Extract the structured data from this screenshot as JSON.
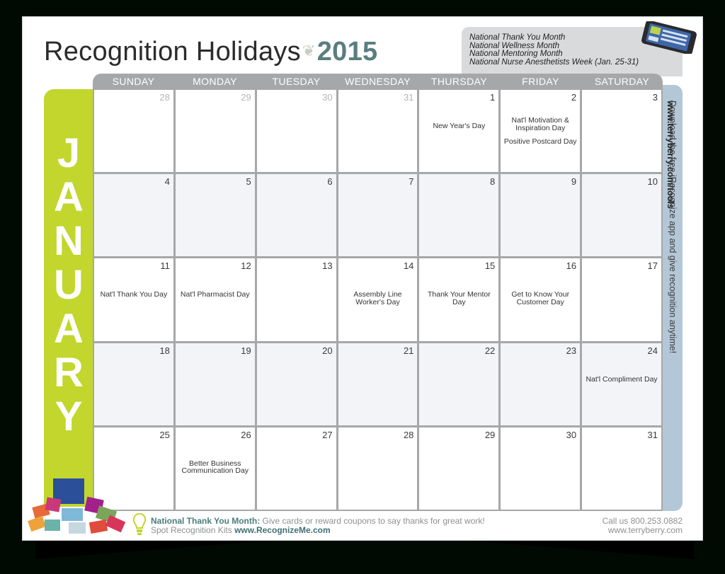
{
  "title": {
    "text": "Recognition Holidays",
    "ornament": "❦",
    "year": "2015"
  },
  "observances": [
    "National Thank You Month",
    "National Wellness Month",
    "National Mentoring Month",
    "National Nurse Anesthetists Week (Jan. 25-31)"
  ],
  "month": "JANUARY",
  "month_letters": [
    "J",
    "A",
    "N",
    "U",
    "A",
    "R",
    "Y"
  ],
  "weekdays": [
    "SUNDAY",
    "MONDAY",
    "TUESDAY",
    "WEDNESDAY",
    "THURSDAY",
    "FRIDAY",
    "SATURDAY"
  ],
  "weeks": [
    [
      {
        "day": "28",
        "outside": true,
        "events": []
      },
      {
        "day": "29",
        "outside": true,
        "events": []
      },
      {
        "day": "30",
        "outside": true,
        "events": []
      },
      {
        "day": "31",
        "outside": true,
        "events": []
      },
      {
        "day": "1",
        "events": [
          "New Year's Day"
        ]
      },
      {
        "day": "2",
        "events": [
          "Nat'l Motivation & Inspiration Day",
          "Positive Postcard Day"
        ]
      },
      {
        "day": "3",
        "events": []
      }
    ],
    [
      {
        "day": "4",
        "events": []
      },
      {
        "day": "5",
        "events": []
      },
      {
        "day": "6",
        "events": []
      },
      {
        "day": "7",
        "events": []
      },
      {
        "day": "8",
        "events": []
      },
      {
        "day": "9",
        "events": []
      },
      {
        "day": "10",
        "events": []
      }
    ],
    [
      {
        "day": "11",
        "events": [
          "Nat'l Thank You Day"
        ]
      },
      {
        "day": "12",
        "events": [
          "Nat'l Pharmacist Day"
        ]
      },
      {
        "day": "13",
        "events": []
      },
      {
        "day": "14",
        "events": [
          "Assembly Line Worker's Day"
        ]
      },
      {
        "day": "15",
        "events": [
          "Thank Your Mentor Day"
        ]
      },
      {
        "day": "16",
        "events": [
          "Get to Know Your Customer Day"
        ]
      },
      {
        "day": "17",
        "events": []
      }
    ],
    [
      {
        "day": "18",
        "events": []
      },
      {
        "day": "19",
        "events": []
      },
      {
        "day": "20",
        "events": []
      },
      {
        "day": "21",
        "events": []
      },
      {
        "day": "22",
        "events": []
      },
      {
        "day": "23",
        "events": []
      },
      {
        "day": "24",
        "events": [
          "Nat'l Compliment Day"
        ]
      }
    ],
    [
      {
        "day": "25",
        "events": []
      },
      {
        "day": "26",
        "events": [
          "Better Business Communication Day"
        ]
      },
      {
        "day": "27",
        "events": []
      },
      {
        "day": "28",
        "events": []
      },
      {
        "day": "29",
        "events": []
      },
      {
        "day": "30",
        "events": []
      },
      {
        "day": "31",
        "events": []
      }
    ]
  ],
  "side_banner": {
    "text": "Download the free iRecognize app and give recognition anytime! ",
    "url": "www.terryberry.com/tools"
  },
  "footer": {
    "highlight": "National Thank You Month:",
    "message": " Give cards or reward coupons to say thanks for great work!",
    "kits_label": "Spot Recognition Kits ",
    "kits_url": "www.RecognizeMe.com",
    "phone": "Call us 800.253.0882",
    "website": "www.terryberry.com"
  },
  "icons": {
    "phone": "smartphone-app-icon",
    "bulb": "lightbulb-icon",
    "kit": "recognition-cards-icon"
  },
  "colors": {
    "accent_green": "#c2d62e",
    "accent_teal": "#5a7e7f",
    "header_gray": "#a6a7a9",
    "side_blue": "#b3c7d6",
    "shaded_row": "#f3f4f8"
  }
}
